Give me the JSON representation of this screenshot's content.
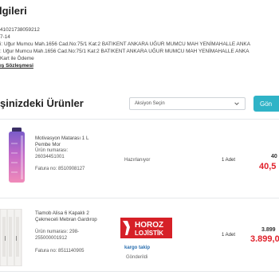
{
  "order_info": {
    "title": "lgileri",
    "lines": [
      "41021738059212",
      "7-14",
      "i: Uğur Mumcu Mah.1656 Cad.No:75/1 Kat:2 BATIKENT ANKARA UĞUR MUMCU MAH YENİMAHALLE ANKA",
      ": Uğur Mumcu Mah.1656 Cad.No:75/1 Kat:2 BATIKENT ANKARA UĞUR MUMCU MAH YENİMAHALLE ANKA",
      "Kart ile Ödeme"
    ],
    "contract_link": "ış Sözleşmesi"
  },
  "products": {
    "title": "şinizdeki Ürünler",
    "action_select": "Aksiyon Seçin",
    "send_button": "Gön",
    "items": [
      {
        "name": "Motivasyon Matarası 1 L Pembe Mor",
        "product_no_label": "Ürün numarası:",
        "product_no": "26034451001",
        "invoice": "Fatura no: 8510908127",
        "status": "Hazırlanıyor",
        "quantity": "1 Adet",
        "price_old": "40",
        "price_new": "40,5"
      },
      {
        "name": "Tiamob Alisa 6 Kapaklı 2 Çekmeceli Mebran Gardırop",
        "product_no_label": "Ürün numarası: 298-",
        "product_no": "255000001912",
        "invoice": "Fatura no: 8511140905",
        "carrier": "HOROZ LOJİSTİK",
        "tracking": "kargo takip",
        "status": "Gönderildi",
        "quantity": "1 Adet",
        "price_old": "3.899",
        "price_new": "3.899,0"
      }
    ]
  },
  "colors": {
    "accent": "#2fb3c7",
    "price_red": "#e0212b",
    "carrier_red": "#d62027"
  }
}
